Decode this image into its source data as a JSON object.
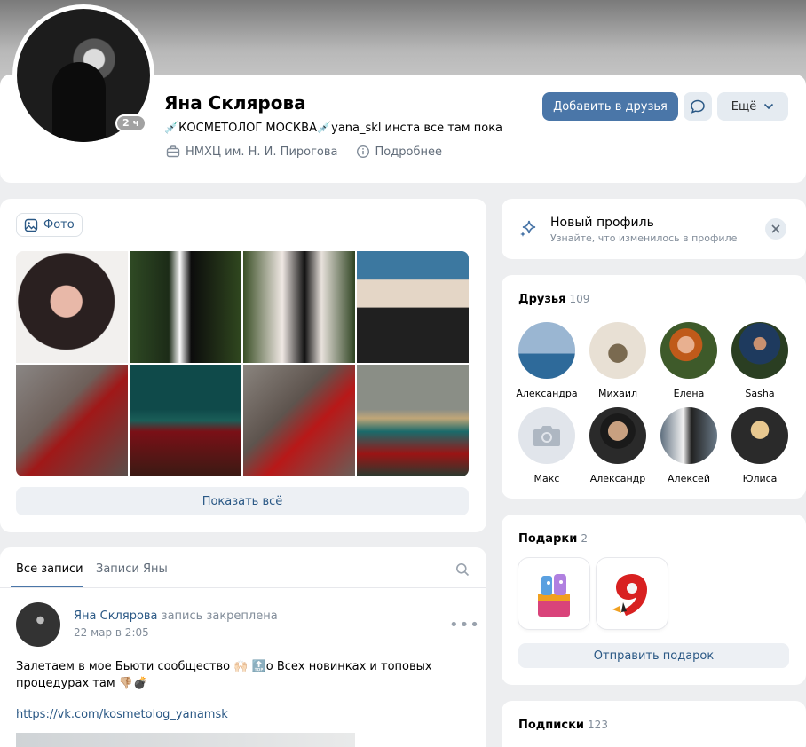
{
  "profile": {
    "name": "Яна Склярова",
    "status": "💉КОСМЕТОЛОГ МОСКВА💉yana_skl инста все там пока",
    "online": "2 ч",
    "work": "НМХЦ им. Н. И. Пирогова",
    "more_info": "Подробнее",
    "add_friend": "Добавить в друзья",
    "more": "Ещё"
  },
  "photos": {
    "chip": "Фото",
    "show_all": "Показать всё"
  },
  "wall": {
    "tabs": [
      "Все записи",
      "Записи Яны"
    ],
    "post": {
      "author": "Яна Склярова",
      "pinned": "запись закреплена",
      "date": "22 мар в 2:05",
      "text": "Залетаем в мое Бьюти сообщество 🙌🏻 🔝о Всех новинках и топовых процедурах там 👎🏼💣",
      "link": "https://vk.com/kosmetolog_yanamsk"
    }
  },
  "new_profile": {
    "title": "Новый профиль",
    "subtitle": "Узнайте, что изменилось в профиле"
  },
  "friends": {
    "title": "Друзья",
    "count": "109",
    "items": [
      "Александра",
      "Михаил",
      "Елена",
      "Sasha",
      "Макс",
      "Александр",
      "Алексей",
      "Юлиса"
    ]
  },
  "gifts": {
    "title": "Подарки",
    "count": "2",
    "send": "Отправить подарок"
  },
  "subscriptions": {
    "title": "Подписки",
    "count": "123"
  },
  "colors": {
    "accent": "#4a76a8",
    "link": "#2a5885",
    "muted": "#818c99",
    "background": "#edeef0"
  }
}
